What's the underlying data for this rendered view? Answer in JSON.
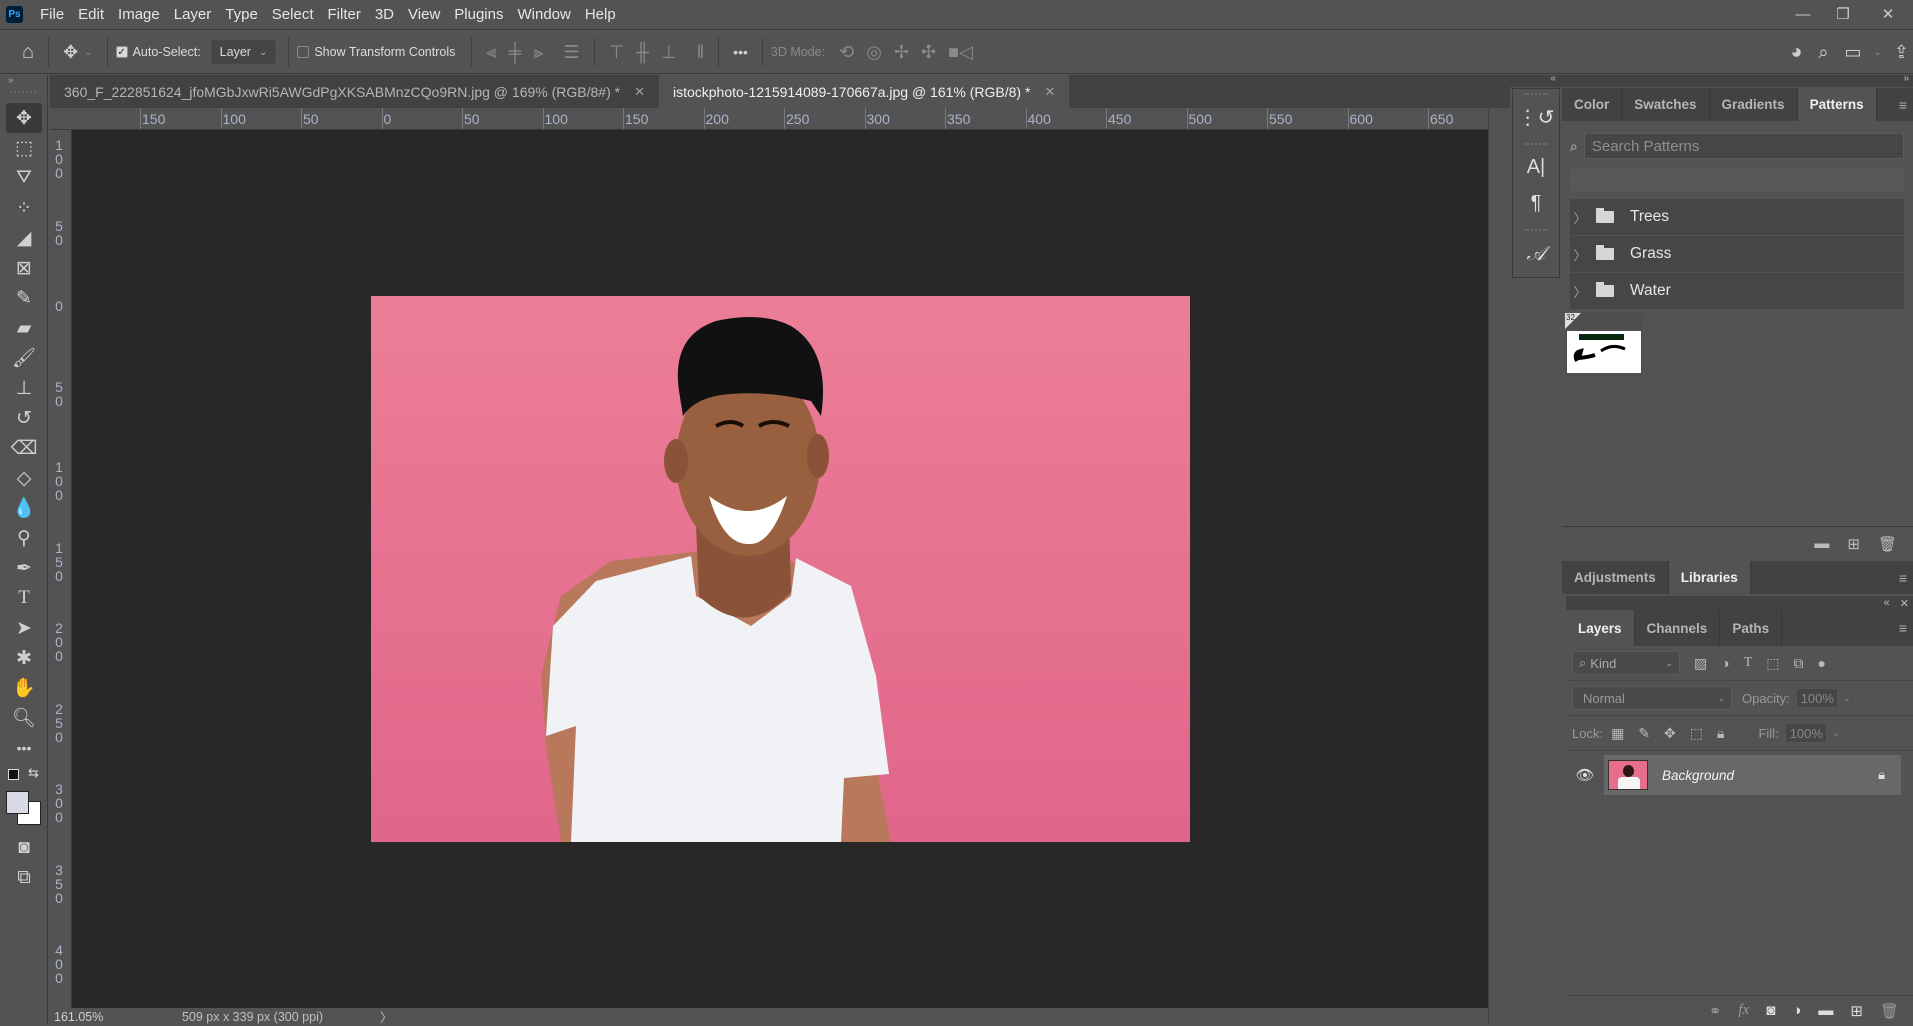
{
  "app": {
    "logo": "Ps",
    "title": "Adobe Photoshop"
  },
  "menu": [
    "File",
    "Edit",
    "Image",
    "Layer",
    "Type",
    "Select",
    "Filter",
    "3D",
    "View",
    "Plugins",
    "Window",
    "Help"
  ],
  "window_controls": {
    "minimize": "—",
    "restore": "❐",
    "close": "✕"
  },
  "options_bar": {
    "auto_select_label": "Auto-Select:",
    "auto_select_checked": true,
    "auto_select_target": "Layer",
    "show_transform_label": "Show Transform Controls",
    "show_transform_checked": false,
    "more_label": "•••",
    "mode_3d_label": "3D Mode:"
  },
  "tabs": [
    {
      "label": "360_F_222851624_jfoMGbJxwRi5AWGdPgXKSABMnzCQo9RN.jpg @ 169% (RGB/8#) *",
      "active": false
    },
    {
      "label": "istockphoto-1215914089-170667a.jpg @ 161% (RGB/8) *",
      "active": true
    }
  ],
  "ruler": {
    "top_labels": [
      "150",
      "100",
      "50",
      "0",
      "50",
      "100",
      "150",
      "200",
      "250",
      "300",
      "350",
      "400",
      "450",
      "500",
      "550",
      "600",
      "650"
    ],
    "left_labels": [
      "100",
      "50",
      "0",
      "50",
      "100",
      "150",
      "200",
      "250",
      "300",
      "350",
      "400"
    ]
  },
  "status": {
    "zoom": "161.05%",
    "doc_info": "509 px x 339 px (300 ppi)",
    "arrow": "〉"
  },
  "colors": {
    "foreground": "#d8dbe3",
    "background": "#ffffff",
    "canvas_bg": "#282828",
    "photo_bg": "#e8748f"
  },
  "patterns_panel": {
    "tabs": [
      "Color",
      "Swatches",
      "Gradients",
      "Patterns"
    ],
    "active_tab": "Patterns",
    "search_placeholder": "Search Patterns",
    "search_value": "",
    "folders": [
      "Trees",
      "Grass",
      "Water"
    ],
    "thumb_badge": "32"
  },
  "adjust_panel": {
    "tabs": [
      "Adjustments",
      "Libraries"
    ],
    "active_tab": "Libraries"
  },
  "layers_panel": {
    "tabs": [
      "Layers",
      "Channels",
      "Paths"
    ],
    "active_tab": "Layers",
    "kind_label": "Kind",
    "blend_mode": "Normal",
    "opacity_label": "Opacity:",
    "opacity_value": "100%",
    "lock_label": "Lock:",
    "fill_label": "Fill:",
    "fill_value": "100%",
    "layers": [
      {
        "name": "Background",
        "visible": true,
        "locked": true
      }
    ]
  }
}
